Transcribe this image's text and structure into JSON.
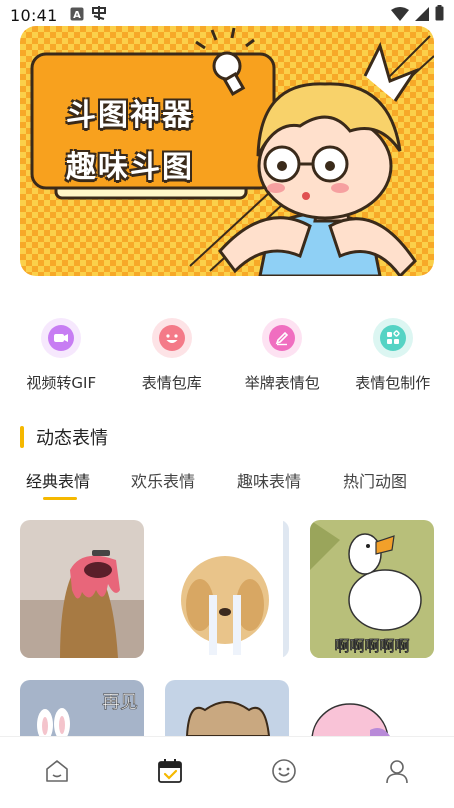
{
  "status_bar": {
    "time": "10:41"
  },
  "banner": {
    "title_line1": "斗图神器",
    "title_line2": "趣味斗图"
  },
  "features": [
    {
      "label": "视频转GIF",
      "icon": "video-camera-icon",
      "color": "#c77df3",
      "bg": "#f6e8fd"
    },
    {
      "label": "表情包库",
      "icon": "smiley-face-icon",
      "color": "#f47a88",
      "bg": "#fde3e6"
    },
    {
      "label": "举牌表情包",
      "icon": "pencil-sign-icon",
      "color": "#f06ec0",
      "bg": "#fde2f2"
    },
    {
      "label": "表情包制作",
      "icon": "grid-make-icon",
      "color": "#55d3c4",
      "bg": "#dcf6f2"
    }
  ],
  "section": {
    "title": "动态表情",
    "accent": "#f5b800"
  },
  "tabs": [
    {
      "label": "经典表情",
      "active": true
    },
    {
      "label": "欢乐表情",
      "active": false
    },
    {
      "label": "趣味表情",
      "active": false
    },
    {
      "label": "热门动图",
      "active": false
    }
  ],
  "tiles": {
    "duck_caption": "啊啊啊啊啊",
    "bye_caption": "再见"
  },
  "bottom_nav": [
    {
      "icon": "home-icon",
      "active": false
    },
    {
      "icon": "calendar-check-icon",
      "active": true
    },
    {
      "icon": "smiley-icon",
      "active": false
    },
    {
      "icon": "user-icon",
      "active": false
    }
  ]
}
